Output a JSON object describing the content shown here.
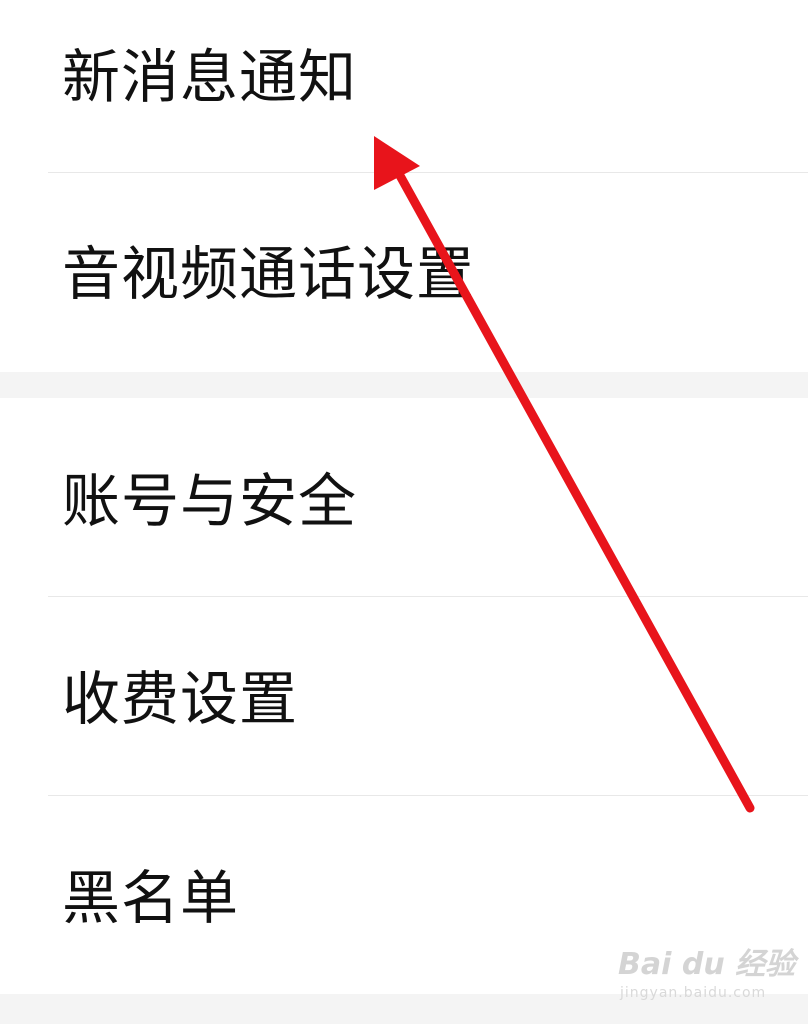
{
  "settings": {
    "sections": [
      {
        "items": [
          {
            "label": "新消息通知"
          },
          {
            "label": "音视频通话设置"
          }
        ]
      },
      {
        "items": [
          {
            "label": "账号与安全"
          },
          {
            "label": "收费设置"
          },
          {
            "label": "黑名单"
          }
        ]
      }
    ]
  },
  "annotation": {
    "arrow_color": "#e8141b",
    "points_to": "新消息通知"
  },
  "watermark": {
    "logo": "Bai du 经验",
    "url": "jingyan.baidu.com"
  }
}
